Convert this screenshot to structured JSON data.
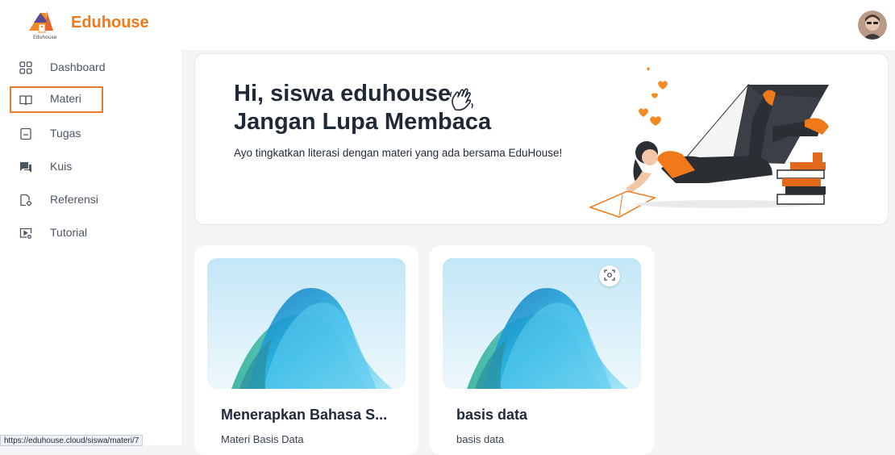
{
  "header": {
    "brand": "Eduhouse",
    "logo_caption": "Eduhouse"
  },
  "sidebar": {
    "items": [
      {
        "label": "Dashboard",
        "icon": "grid-icon"
      },
      {
        "label": "Materi",
        "icon": "book-icon",
        "active": true
      },
      {
        "label": "Tugas",
        "icon": "clipboard-icon"
      },
      {
        "label": "Kuis",
        "icon": "chat-icon"
      },
      {
        "label": "Referensi",
        "icon": "document-settings-icon"
      },
      {
        "label": "Tutorial",
        "icon": "video-settings-icon"
      }
    ]
  },
  "hero": {
    "line1": "Hi, siswa eduhouse",
    "line2": "Jangan Lupa Membaca",
    "subtitle": "Ayo tingkatkan literasi dengan materi yang ada bersama EduHouse!"
  },
  "cards": [
    {
      "title": "Menerapkan Bahasa S...",
      "subtitle": "Materi Basis Data"
    },
    {
      "title": "basis data",
      "subtitle": "basis data"
    }
  ],
  "status_bar": {
    "url": "https://eduhouse.cloud/siswa/materi/7"
  },
  "colors": {
    "accent": "#f07a1a",
    "active_border": "#e87a2c",
    "background": "#f3f4f6"
  }
}
